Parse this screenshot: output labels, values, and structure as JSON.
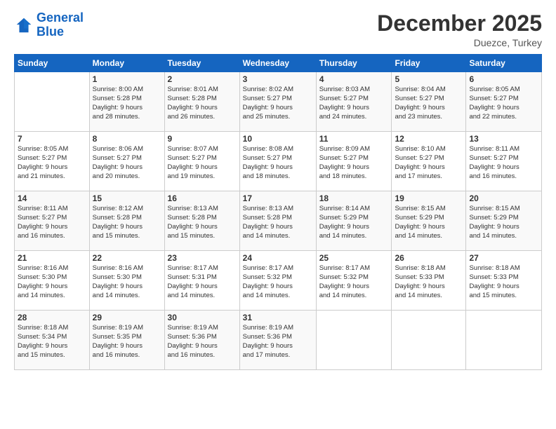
{
  "logo": {
    "line1": "General",
    "line2": "Blue"
  },
  "header": {
    "month": "December 2025",
    "location": "Duezce, Turkey"
  },
  "weekdays": [
    "Sunday",
    "Monday",
    "Tuesday",
    "Wednesday",
    "Thursday",
    "Friday",
    "Saturday"
  ],
  "weeks": [
    [
      {
        "day": "",
        "info": ""
      },
      {
        "day": "1",
        "info": "Sunrise: 8:00 AM\nSunset: 5:28 PM\nDaylight: 9 hours\nand 28 minutes."
      },
      {
        "day": "2",
        "info": "Sunrise: 8:01 AM\nSunset: 5:28 PM\nDaylight: 9 hours\nand 26 minutes."
      },
      {
        "day": "3",
        "info": "Sunrise: 8:02 AM\nSunset: 5:27 PM\nDaylight: 9 hours\nand 25 minutes."
      },
      {
        "day": "4",
        "info": "Sunrise: 8:03 AM\nSunset: 5:27 PM\nDaylight: 9 hours\nand 24 minutes."
      },
      {
        "day": "5",
        "info": "Sunrise: 8:04 AM\nSunset: 5:27 PM\nDaylight: 9 hours\nand 23 minutes."
      },
      {
        "day": "6",
        "info": "Sunrise: 8:05 AM\nSunset: 5:27 PM\nDaylight: 9 hours\nand 22 minutes."
      }
    ],
    [
      {
        "day": "7",
        "info": "Sunrise: 8:05 AM\nSunset: 5:27 PM\nDaylight: 9 hours\nand 21 minutes."
      },
      {
        "day": "8",
        "info": "Sunrise: 8:06 AM\nSunset: 5:27 PM\nDaylight: 9 hours\nand 20 minutes."
      },
      {
        "day": "9",
        "info": "Sunrise: 8:07 AM\nSunset: 5:27 PM\nDaylight: 9 hours\nand 19 minutes."
      },
      {
        "day": "10",
        "info": "Sunrise: 8:08 AM\nSunset: 5:27 PM\nDaylight: 9 hours\nand 18 minutes."
      },
      {
        "day": "11",
        "info": "Sunrise: 8:09 AM\nSunset: 5:27 PM\nDaylight: 9 hours\nand 18 minutes."
      },
      {
        "day": "12",
        "info": "Sunrise: 8:10 AM\nSunset: 5:27 PM\nDaylight: 9 hours\nand 17 minutes."
      },
      {
        "day": "13",
        "info": "Sunrise: 8:11 AM\nSunset: 5:27 PM\nDaylight: 9 hours\nand 16 minutes."
      }
    ],
    [
      {
        "day": "14",
        "info": "Sunrise: 8:11 AM\nSunset: 5:27 PM\nDaylight: 9 hours\nand 16 minutes."
      },
      {
        "day": "15",
        "info": "Sunrise: 8:12 AM\nSunset: 5:28 PM\nDaylight: 9 hours\nand 15 minutes."
      },
      {
        "day": "16",
        "info": "Sunrise: 8:13 AM\nSunset: 5:28 PM\nDaylight: 9 hours\nand 15 minutes."
      },
      {
        "day": "17",
        "info": "Sunrise: 8:13 AM\nSunset: 5:28 PM\nDaylight: 9 hours\nand 14 minutes."
      },
      {
        "day": "18",
        "info": "Sunrise: 8:14 AM\nSunset: 5:29 PM\nDaylight: 9 hours\nand 14 minutes."
      },
      {
        "day": "19",
        "info": "Sunrise: 8:15 AM\nSunset: 5:29 PM\nDaylight: 9 hours\nand 14 minutes."
      },
      {
        "day": "20",
        "info": "Sunrise: 8:15 AM\nSunset: 5:29 PM\nDaylight: 9 hours\nand 14 minutes."
      }
    ],
    [
      {
        "day": "21",
        "info": "Sunrise: 8:16 AM\nSunset: 5:30 PM\nDaylight: 9 hours\nand 14 minutes."
      },
      {
        "day": "22",
        "info": "Sunrise: 8:16 AM\nSunset: 5:30 PM\nDaylight: 9 hours\nand 14 minutes."
      },
      {
        "day": "23",
        "info": "Sunrise: 8:17 AM\nSunset: 5:31 PM\nDaylight: 9 hours\nand 14 minutes."
      },
      {
        "day": "24",
        "info": "Sunrise: 8:17 AM\nSunset: 5:32 PM\nDaylight: 9 hours\nand 14 minutes."
      },
      {
        "day": "25",
        "info": "Sunrise: 8:17 AM\nSunset: 5:32 PM\nDaylight: 9 hours\nand 14 minutes."
      },
      {
        "day": "26",
        "info": "Sunrise: 8:18 AM\nSunset: 5:33 PM\nDaylight: 9 hours\nand 14 minutes."
      },
      {
        "day": "27",
        "info": "Sunrise: 8:18 AM\nSunset: 5:33 PM\nDaylight: 9 hours\nand 15 minutes."
      }
    ],
    [
      {
        "day": "28",
        "info": "Sunrise: 8:18 AM\nSunset: 5:34 PM\nDaylight: 9 hours\nand 15 minutes."
      },
      {
        "day": "29",
        "info": "Sunrise: 8:19 AM\nSunset: 5:35 PM\nDaylight: 9 hours\nand 16 minutes."
      },
      {
        "day": "30",
        "info": "Sunrise: 8:19 AM\nSunset: 5:36 PM\nDaylight: 9 hours\nand 16 minutes."
      },
      {
        "day": "31",
        "info": "Sunrise: 8:19 AM\nSunset: 5:36 PM\nDaylight: 9 hours\nand 17 minutes."
      },
      {
        "day": "",
        "info": ""
      },
      {
        "day": "",
        "info": ""
      },
      {
        "day": "",
        "info": ""
      }
    ]
  ]
}
